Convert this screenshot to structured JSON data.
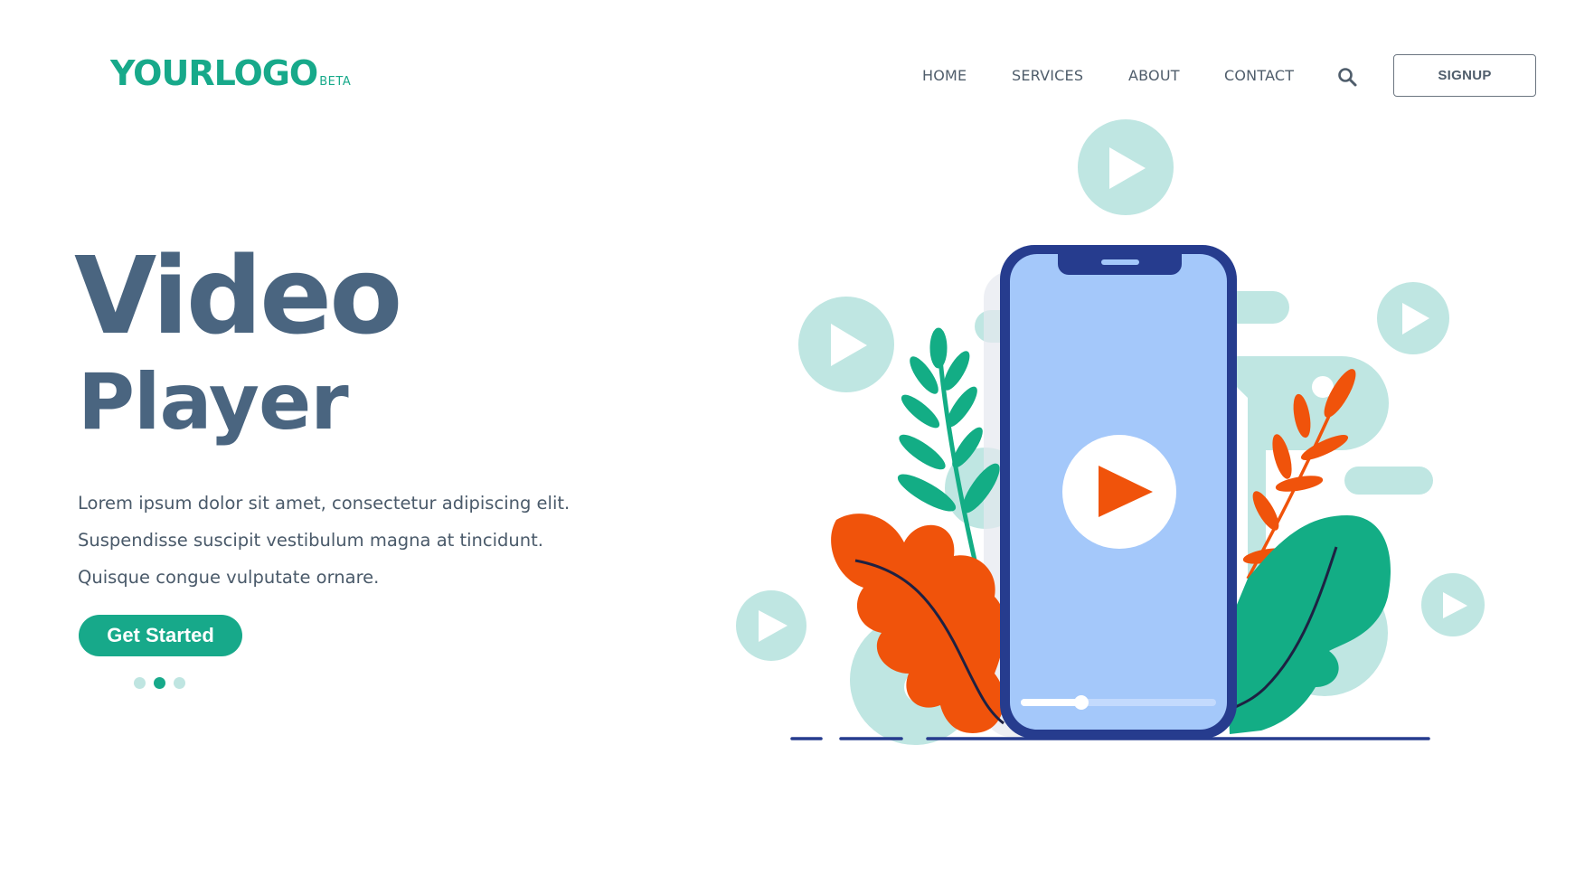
{
  "header": {
    "logo": {
      "text": "YOURLOGO",
      "badge": "BETA"
    },
    "nav": [
      {
        "label": "HOME"
      },
      {
        "label": "SERVICES"
      },
      {
        "label": "ABOUT"
      },
      {
        "label": "CONTACT"
      }
    ],
    "search_icon": "search-icon",
    "signup_label": "SIGNUP"
  },
  "hero": {
    "title_line1": "Video",
    "title_line2": "Player",
    "paragraph": [
      "Lorem ipsum dolor sit amet, consectetur adipiscing elit.",
      "Suspendisse suscipit vestibulum magna at tincidunt.",
      "Quisque congue vulputate ornare."
    ],
    "cta_label": "Get Started",
    "carousel": {
      "total": 3,
      "active_index": 1
    }
  },
  "illustration": {
    "player_progress": 0.31,
    "play_icon": "play-icon"
  },
  "colors": {
    "brand": "#17a98a",
    "heading": "#4a6580",
    "phone_frame": "#263c8e",
    "phone_screen": "#a4c8fa",
    "accent_orange": "#f0530b",
    "leaf_green": "#13ad85",
    "bubble": "#bfe6e2"
  }
}
